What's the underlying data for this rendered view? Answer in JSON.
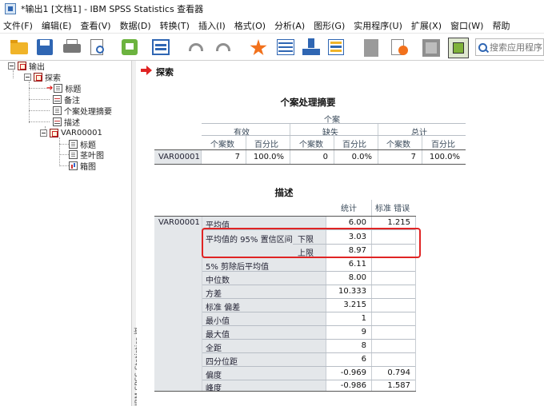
{
  "window": {
    "title": "*输出1 [文档1] - IBM SPSS Statistics 查看器"
  },
  "menu": [
    "文件(F)",
    "编辑(E)",
    "查看(V)",
    "数据(D)",
    "转换(T)",
    "插入(I)",
    "格式(O)",
    "分析(A)",
    "图形(G)",
    "实用程序(U)",
    "扩展(X)",
    "窗口(W)",
    "帮助"
  ],
  "toolbar": {
    "icons": [
      "open-folder-icon",
      "save-icon",
      "print-icon",
      "print-preview-icon",
      "export-icon",
      "dialog-recall-icon",
      "undo-icon",
      "redo-icon",
      "goto-case-icon",
      "goto-variable-icon",
      "insert-output-icon",
      "designate-window-icon",
      "select-last-output-icon",
      "select-all-icon",
      "promote-icon",
      "demote-icon",
      "show-hide-icon"
    ],
    "search_placeholder": "搜索应用程序"
  },
  "outline": {
    "root": "输出",
    "explore": "探索",
    "items": [
      "标题",
      "备注",
      "个案处理摘要",
      "描述"
    ],
    "var": "VAR00001",
    "var_items": [
      "标题",
      "茎叶图",
      "箱图"
    ]
  },
  "viewer": {
    "section_title": "探索",
    "vscroll_label": "IBM SPSS Statistics 查看器"
  },
  "case_summary": {
    "title": "个案处理摘要",
    "group_header": "个案",
    "col_groups": [
      "有效",
      "缺失",
      "总计"
    ],
    "sub_headers": [
      "个案数",
      "百分比",
      "个案数",
      "百分比",
      "个案数",
      "百分比"
    ],
    "row_label": "VAR00001",
    "values": [
      "7",
      "100.0%",
      "0",
      "0.0%",
      "7",
      "100.0%"
    ]
  },
  "descriptives": {
    "title": "描述",
    "col_headers": [
      "统计",
      "标准 错误"
    ],
    "var_label": "VAR00001",
    "rows": [
      {
        "label": "平均值",
        "sub": "",
        "stat": "6.00",
        "se": "1.215"
      },
      {
        "label": "平均值的 95% 置信区间",
        "sub": "下限",
        "stat": "3.03",
        "se": ""
      },
      {
        "label": "",
        "sub": "上限",
        "stat": "8.97",
        "se": ""
      },
      {
        "label": "5% 剪除后平均值",
        "sub": "",
        "stat": "6.11",
        "se": ""
      },
      {
        "label": "中位数",
        "sub": "",
        "stat": "8.00",
        "se": ""
      },
      {
        "label": "方差",
        "sub": "",
        "stat": "10.333",
        "se": ""
      },
      {
        "label": "标准 偏差",
        "sub": "",
        "stat": "3.215",
        "se": ""
      },
      {
        "label": "最小值",
        "sub": "",
        "stat": "1",
        "se": ""
      },
      {
        "label": "最大值",
        "sub": "",
        "stat": "9",
        "se": ""
      },
      {
        "label": "全距",
        "sub": "",
        "stat": "8",
        "se": ""
      },
      {
        "label": "四分位距",
        "sub": "",
        "stat": "6",
        "se": ""
      },
      {
        "label": "偏度",
        "sub": "",
        "stat": "-0.969",
        "se": "0.794"
      },
      {
        "label": "峰度",
        "sub": "",
        "stat": "-0.986",
        "se": "1.587"
      }
    ]
  },
  "colors": {
    "highlight": "#e02424",
    "accent": "#2f66b3",
    "header_bg": "#e4e7ea"
  }
}
